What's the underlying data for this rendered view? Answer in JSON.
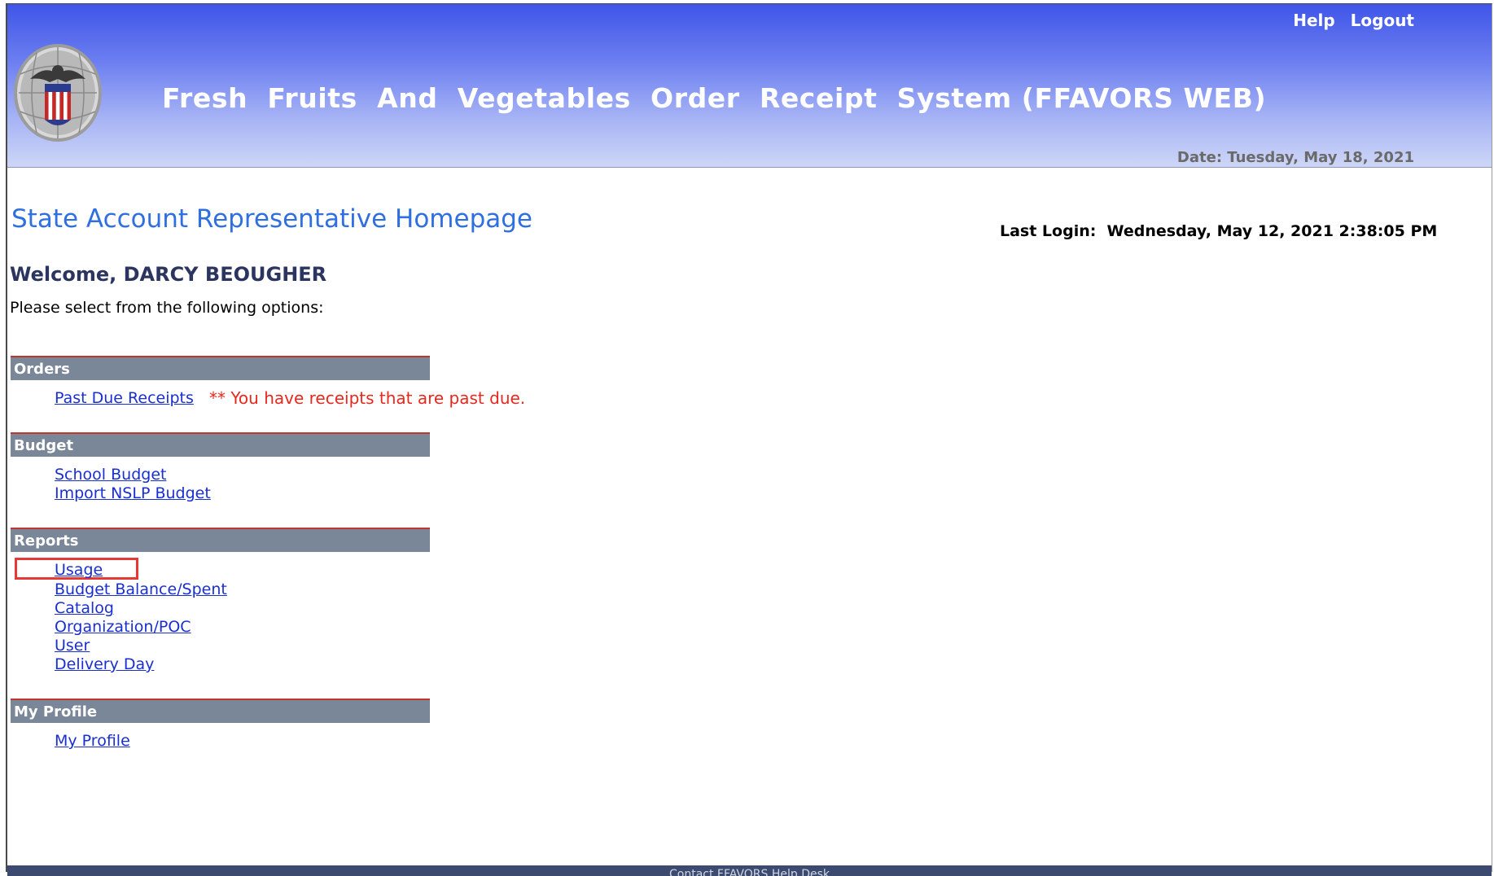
{
  "header": {
    "help_label": "Help",
    "logout_label": "Logout",
    "app_title": "Fresh  Fruits  And  Vegetables  Order  Receipt  System (FFAVORS WEB)",
    "date_text": "Date: Tuesday, May 18, 2021",
    "logo_icon": "dla-seal-icon"
  },
  "page": {
    "title": "State Account Representative Homepage",
    "last_login": "Last Login:  Wednesday, May 12, 2021 2:38:05 PM",
    "welcome": "Welcome, DARCY BEOUGHER",
    "instructions": "Please select from the following options:"
  },
  "sections": {
    "orders": {
      "heading": "Orders",
      "past_due": "Past Due Receipts",
      "warning": "** You have receipts that are past due."
    },
    "budget": {
      "heading": "Budget",
      "links": [
        "School Budget",
        "Import NSLP Budget"
      ]
    },
    "reports": {
      "heading": "Reports",
      "links": [
        "Usage",
        "Budget Balance/Spent",
        "Catalog",
        "Organization/POC",
        "User",
        "Delivery Day"
      ]
    },
    "profile": {
      "heading": "My Profile",
      "links": [
        "My Profile"
      ]
    }
  },
  "footer": {
    "text": "Contact FFAVORS Help Desk"
  },
  "colors": {
    "header_top": "#3f55e8",
    "section_bar": "#7a8798",
    "link": "#1a2fd0",
    "warning": "#e8281e",
    "title": "#2f6fe0"
  }
}
